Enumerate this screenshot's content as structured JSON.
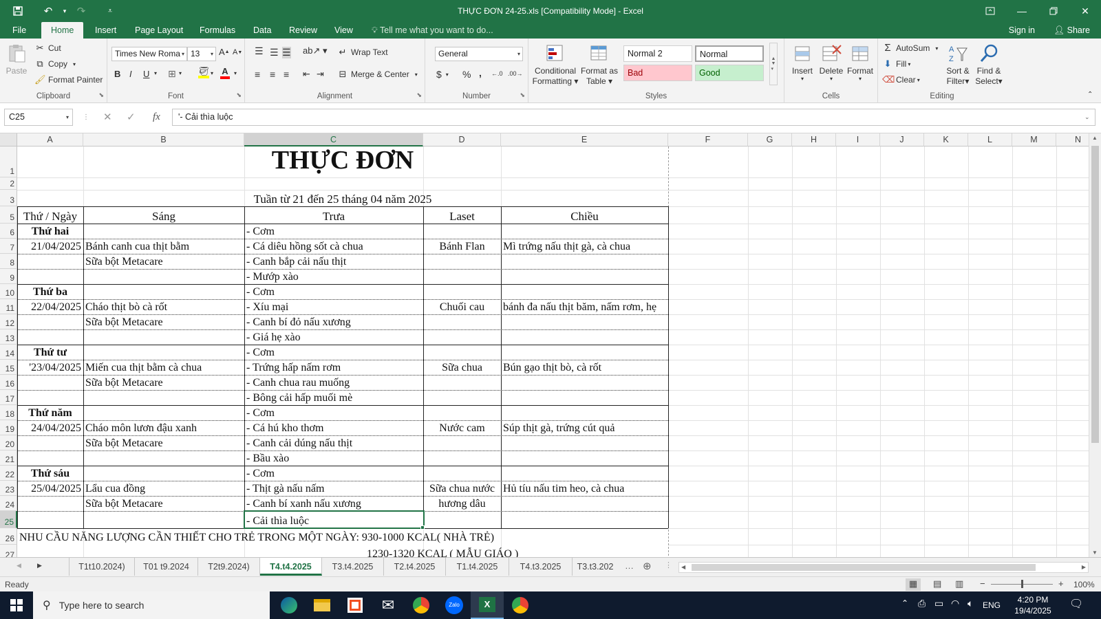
{
  "window": {
    "title": "THỰC ĐƠN 24-25.xls  [Compatibility Mode] - Excel"
  },
  "ribbon_tabs": [
    "File",
    "Home",
    "Insert",
    "Page Layout",
    "Formulas",
    "Data",
    "Review",
    "View"
  ],
  "tell_me": "Tell me what you want to do...",
  "account": {
    "sign_in": "Sign in",
    "share": "Share"
  },
  "clipboard": {
    "paste": "Paste",
    "cut": "Cut",
    "copy": "Copy",
    "format_painter": "Format Painter",
    "label": "Clipboard"
  },
  "font": {
    "name": "Times New Roma",
    "size": "13",
    "bold": "B",
    "italic": "I",
    "underline": "U",
    "label": "Font"
  },
  "alignment": {
    "wrap_text": "Wrap Text",
    "merge_center": "Merge & Center",
    "label": "Alignment"
  },
  "number": {
    "format": "General",
    "currency": "$",
    "percent": "%",
    "comma": ",",
    "label": "Number"
  },
  "styles": {
    "conditional": "Conditional",
    "conditional2": "Formatting",
    "format_as": "Format as",
    "format_as2": "Table",
    "normal2": "Normal 2",
    "normal": "Normal",
    "bad": "Bad",
    "good": "Good",
    "label": "Styles",
    "bad_color": "#ffc7ce",
    "good_color": "#c6efce"
  },
  "cells": {
    "insert": "Insert",
    "delete": "Delete",
    "format": "Format",
    "label": "Cells"
  },
  "editing": {
    "autosum": "AutoSum",
    "fill": "Fill",
    "clear": "Clear",
    "sort": "Sort &",
    "sort2": "Filter",
    "find": "Find &",
    "find2": "Select",
    "label": "Editing"
  },
  "formula_bar": {
    "name_box": "C25",
    "formula": "'- Cải thìa luộc",
    "cancel": "✕",
    "enter": "✓",
    "fx": "fx"
  },
  "columns": [
    "A",
    "B",
    "C",
    "D",
    "E",
    "F",
    "G",
    "H",
    "I",
    "J",
    "K",
    "L",
    "M",
    "N"
  ],
  "rows": [
    "1",
    "2",
    "3",
    "5",
    "6",
    "7",
    "8",
    "9",
    "10",
    "11",
    "12",
    "13",
    "14",
    "15",
    "16",
    "17",
    "18",
    "19",
    "20",
    "21",
    "22",
    "23",
    "24",
    "25",
    "26",
    "27"
  ],
  "sheet": {
    "title": "THỰC ĐƠN",
    "week": "Tuần từ 21 đến 25 tháng 04 năm 2025",
    "headers": [
      "Thứ / Ngày",
      "Sáng",
      "Trưa",
      "Laset",
      "Chiều"
    ],
    "days": [
      {
        "name": "Thứ hai",
        "date": "21/04/2025",
        "morning": [
          "Bánh canh cua thịt bằm",
          "Sữa bột Metacare"
        ],
        "lunch": [
          "- Cơm",
          "- Cá diêu hồng sốt cà chua",
          "- Canh bắp cải nấu thịt",
          "- Mướp xào"
        ],
        "snack": "Bánh Flan",
        "afternoon": "Mì trứng nấu thịt gà, cà chua"
      },
      {
        "name": "Thứ ba",
        "date": "22/04/2025",
        "morning": [
          "Cháo thịt bò cà rốt",
          "Sữa bột Metacare"
        ],
        "lunch": [
          "- Cơm",
          "- Xíu mại",
          "- Canh bí đỏ nấu xương",
          "- Giá hẹ xào"
        ],
        "snack": "Chuối cau",
        "afternoon": "bánh đa nấu thịt băm, nấm rơm, hẹ"
      },
      {
        "name": "Thứ tư",
        "date": "'23/04/2025",
        "morning": [
          "Miến cua thịt bằm cà chua",
          "Sữa bột Metacare"
        ],
        "lunch": [
          "- Cơm",
          "- Trứng hấp nấm rơm",
          "- Canh chua rau muống",
          "- Bông cải hấp muối mè"
        ],
        "snack": "Sữa chua",
        "afternoon": "Bún gạo thịt bò, cà rốt"
      },
      {
        "name": "Thứ năm",
        "date": "24/04/2025",
        "morning": [
          "Cháo môn lươn đậu xanh",
          "Sữa bột Metacare"
        ],
        "lunch": [
          "- Cơm",
          "- Cá hú kho thơm",
          "- Canh cải dúng nấu thịt",
          "- Bầu xào"
        ],
        "snack": "Nước cam",
        "afternoon": "Súp thịt gà, trứng cút quả"
      },
      {
        "name": "Thứ sáu",
        "date": "25/04/2025",
        "morning": [
          "Lẩu cua đồng",
          "Sữa bột Metacare"
        ],
        "lunch": [
          "- Cơm",
          "- Thịt gà nấu nấm",
          "- Canh bí xanh nấu xương",
          "- Cải thìa luộc"
        ],
        "snack": [
          "Sữa chua nước",
          "hương dâu"
        ],
        "afternoon": "Hủ tíu nấu tim heo, cà chua"
      }
    ],
    "energy": "NHU CẦU NĂNG LƯỢNG CẦN THIẾT CHO TRẺ TRONG MỘT NGÀY: 930-1000 KCAL( NHÀ TRẺ)",
    "energy2": "1230-1320 KCAL ( MẪU GIÁO )"
  },
  "sheet_tabs": [
    "T1t10.2024)",
    "T01 t9.2024",
    "T2t9.2024)",
    "T4.t4.2025",
    "T3.t4.2025",
    "T2.t4.2025",
    "T1.t4.2025",
    "T4.t3.2025",
    "T3.t3.202"
  ],
  "active_sheet": "T4.t4.2025",
  "status": {
    "ready": "Ready",
    "zoom": "100%"
  },
  "taskbar": {
    "search": "Type here to search",
    "time": "4:20 PM",
    "date": "19/4/2025",
    "lang": "ENG"
  },
  "colors": {
    "accent": "#217346"
  }
}
